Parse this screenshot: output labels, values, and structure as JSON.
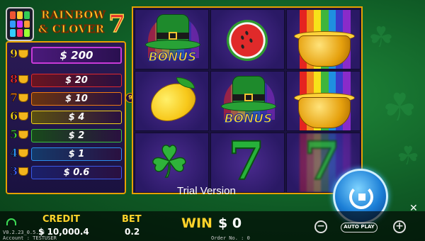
{
  "game": {
    "logo_line1": "RAINBOW",
    "logo_line2": "& CLOVER",
    "logo_seven": "7"
  },
  "paytable": [
    {
      "count": "9",
      "prize": "$ 200",
      "color": "#c83ad8"
    },
    {
      "count": "8",
      "prize": "$ 20",
      "color": "#e0282e"
    },
    {
      "count": "7",
      "prize": "$ 10",
      "color": "#f07a12"
    },
    {
      "count": "6",
      "prize": "$ 4",
      "color": "#f2d21a"
    },
    {
      "count": "5",
      "prize": "$ 2",
      "color": "#3cc43c"
    },
    {
      "count": "4",
      "prize": "$ 1",
      "color": "#2b8ff0"
    },
    {
      "count": "3",
      "prize": "$ 0.6",
      "color": "#3a58e8"
    }
  ],
  "reel_marker": "9",
  "reels": {
    "symbols": [
      [
        "bonus-hat",
        "lemon",
        "clover"
      ],
      [
        "watermelon",
        "bonus-hat",
        "seven"
      ],
      [
        "pot-of-gold",
        "pot-of-gold",
        "seven"
      ]
    ],
    "bonus_label": "BONUS",
    "seven_label": "7",
    "clover_glyph": "☘"
  },
  "overlay": {
    "trial_text": "Trial Version"
  },
  "footer": {
    "credit_label": "CREDIT",
    "credit_value": "$ 10,000.4",
    "bet_label": "BET",
    "bet_value": "0.2",
    "win_label": "WIN",
    "win_value": "$ 0",
    "version": "V0.2.23_0.5.58",
    "account": "Account : TESTUSER",
    "order": "Order No. : 0",
    "minus": "−",
    "plus": "+",
    "autoplay_label": "AUTO PLAY"
  },
  "icons": {
    "wifi": "wifi-icon",
    "spin": "spin-icon",
    "settings": "tools-icon"
  },
  "colors": {
    "gold": "#ffd32a",
    "panel": "#1a1240",
    "frame": "#e6a100"
  }
}
